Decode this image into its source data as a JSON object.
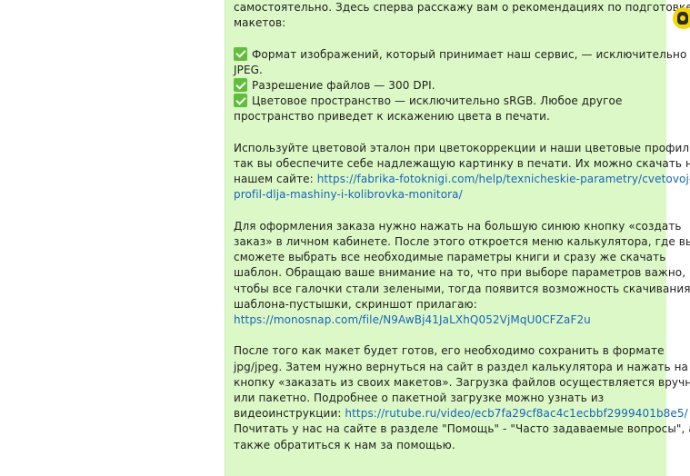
{
  "message": {
    "lines": [
      "самостоятельно. Здесь сперва расскажу вам о рекомендациях по подготовке",
      "макетов:"
    ],
    "checklist": {
      "item1_line1": "Формат изображений, который принимает наш сервис, — исключительно",
      "item1_line2": "JPEG.",
      "item2": "Разрешение файлов — 300 DPI.",
      "item3_line1": "Цветовое пространство — исключительно sRGB. Любое другое",
      "item3_line2": "пространство приведет к искажению цвета в печати."
    },
    "para2": {
      "line1": "Используйте цветовой эталон при цветокоррекции и наши цветовые профили,",
      "line2": "так вы обеспечите себе надлежащую картинку в печати. Их можно скачать на",
      "line3_prefix": "нашем сайте: ",
      "link_part1": "https://fabrika-fotoknigi.com/help/texnicheskie-parametry/cvetovoj-",
      "link_part2": "profil-dlja-mashiny-i-kolibrovka-monitora/"
    },
    "para3": {
      "line1": "Для оформления заказа нужно нажать на большую синюю кнопку «создать",
      "line2": "заказ» в личном кабинете. После этого откроется меню калькулятора, где вы",
      "line3": "сможете выбрать все необходимые параметры книги и сразу же скачать",
      "line4": "шаблон. Обращаю ваше внимание на то, что при выборе параметров важно,",
      "line5": "чтобы все галочки стали зелеными, тогда появится возможность скачивания",
      "line6": "шаблона-пустышки, скриншот прилагаю:",
      "link": "https://monosnap.com/file/N9AwBj41JaLXhQ052VjMqU0CFZaF2u"
    },
    "para4": {
      "line1": "После того как макет будет готов, его необходимо сохранить в формате",
      "line2": "jpg/jpeg. Затем нужно вернуться на сайт в раздел калькулятора и нажать на",
      "line3": "кнопку «заказать из своих макетов». Загрузка файлов осуществляется вручную",
      "line4": "или пакетно. Подробнее о пакетной загрузке можно узнать из",
      "line5_prefix": "видеоинструкции: ",
      "link": "https://rutube.ru/video/ecb7fa29cf8ac4c1ecbbf2999401b8e5/",
      "line6": "Почитать у нас на сайте в разделе \"Помощь\" - \"Часто задаваемые вопросы\", а",
      "line7": "также обратиться к нам за помощью."
    }
  },
  "colors": {
    "bubble_bg": "#dcf8c6",
    "link": "#1565c0",
    "check": "#5fbf3a",
    "avatar": "#f5d800"
  },
  "icons": {
    "check": "check-mark-icon",
    "avatar": "avatar"
  }
}
